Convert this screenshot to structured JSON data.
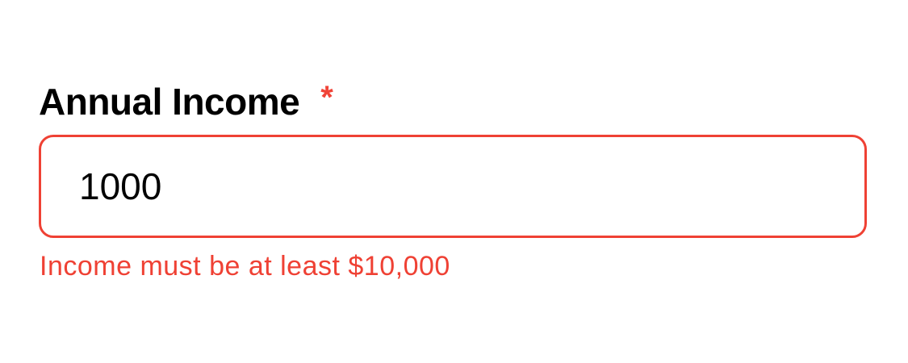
{
  "field": {
    "label": "Annual Income",
    "required_marker": "*",
    "value": "1000",
    "error_message": "Income must be at least $10,000"
  },
  "colors": {
    "error": "#ef4134",
    "label": "#000000",
    "background": "#ffffff"
  }
}
